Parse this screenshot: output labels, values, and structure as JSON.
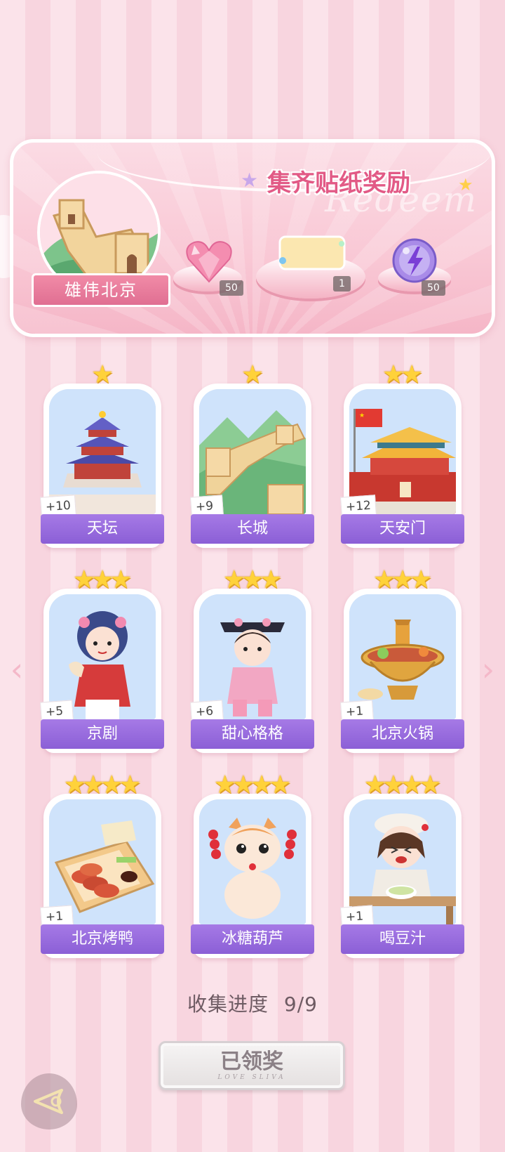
{
  "banner": {
    "title": "集齐贴纸奖励",
    "watermark": "Redeem",
    "location_name": "雄伟北京",
    "rewards": [
      {
        "icon": "pink-heart-gem-icon",
        "count": "50"
      },
      {
        "icon": "sticker-card-icon",
        "count": "1"
      },
      {
        "icon": "purple-lightning-orb-icon",
        "count": "50"
      }
    ]
  },
  "cards": [
    {
      "name": "天坛",
      "bonus": "+10",
      "stars": 1,
      "icon": "temple-of-heaven-icon"
    },
    {
      "name": "长城",
      "bonus": "+9",
      "stars": 1,
      "icon": "great-wall-icon"
    },
    {
      "name": "天安门",
      "bonus": "+12",
      "stars": 2,
      "icon": "tiananmen-icon"
    },
    {
      "name": "京剧",
      "bonus": "+5",
      "stars": 3,
      "icon": "peking-opera-icon"
    },
    {
      "name": "甜心格格",
      "bonus": "+6",
      "stars": 3,
      "icon": "qing-princess-icon"
    },
    {
      "name": "北京火锅",
      "bonus": "+1",
      "stars": 3,
      "icon": "hotpot-icon"
    },
    {
      "name": "北京烤鸭",
      "bonus": "+1",
      "stars": 4,
      "icon": "roast-duck-icon"
    },
    {
      "name": "冰糖葫芦",
      "bonus": "",
      "stars": 4,
      "icon": "candied-haws-cat-icon"
    },
    {
      "name": "喝豆汁",
      "bonus": "+1",
      "stars": 4,
      "icon": "douzhi-girl-icon"
    }
  ],
  "progress": {
    "label": "收集进度",
    "value": "9/9"
  },
  "claim_button": {
    "label": "已领奖",
    "sub": "LOVE SLIVA"
  },
  "colors": {
    "accent": "#e25a86",
    "label_purple": "#8b5fd6",
    "star": "#ffd23a"
  }
}
